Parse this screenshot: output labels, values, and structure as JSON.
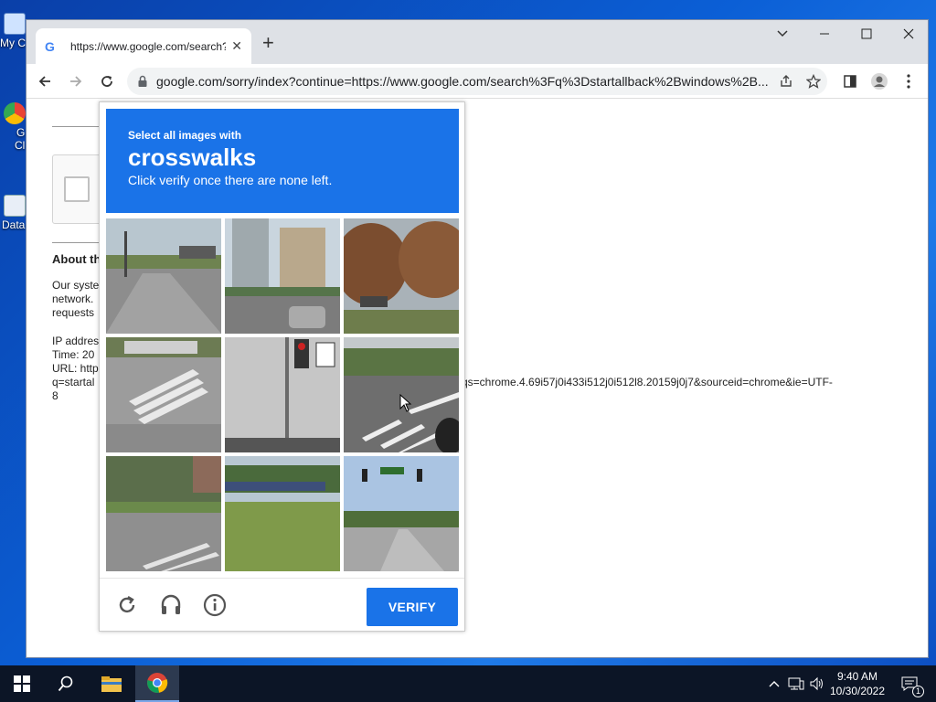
{
  "desktop": {
    "icons": [
      {
        "label": "My C"
      },
      {
        "label": "G"
      },
      {
        "label": "Cl"
      },
      {
        "label": "Data"
      }
    ]
  },
  "browser": {
    "tab": {
      "favicon": "G",
      "title": "https://www.google.com/search?q"
    },
    "address": "google.com/sorry/index?continue=https://www.google.com/search%3Fq%3Dstartallback%2Bwindows%2B...",
    "controls": {
      "minimize": "—",
      "maximize": "☐",
      "close": "✕",
      "dropdown": "⌄"
    }
  },
  "page": {
    "about_heading": "About th",
    "para_lines": [
      "Our syste",
      "network.",
      "requests"
    ],
    "info_lines": [
      "IP addres",
      "Time: 20",
      "URL: http",
      "q=startal",
      "8"
    ],
    "url_tail": "qs=chrome.4.69i57j0i433i512j0i512l8.20159j0j7&sourceid=chrome&ie=UTF-"
  },
  "captcha": {
    "instruction_line1": "Select all images with",
    "keyword": "crosswalks",
    "instruction_line3": "Click verify once there are none left.",
    "verify_label": "VERIFY",
    "tiles": [
      {
        "desc": "street-corner"
      },
      {
        "desc": "tall-buildings-cars"
      },
      {
        "desc": "trees-autumn"
      },
      {
        "desc": "crosswalk-parking"
      },
      {
        "desc": "traffic-light-pole"
      },
      {
        "desc": "crosswalk-intersection"
      },
      {
        "desc": "road-crosswalk-trees"
      },
      {
        "desc": "overpass-grass"
      },
      {
        "desc": "road-traffic-lights"
      }
    ]
  },
  "taskbar": {
    "time": "9:40 AM",
    "date": "10/30/2022",
    "notification_count": "1"
  },
  "colors": {
    "accent": "#1a73e8",
    "taskbar": "#0c1526"
  }
}
